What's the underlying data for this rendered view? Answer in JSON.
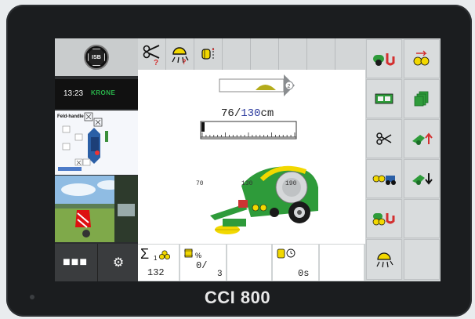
{
  "device": {
    "brand": "CCI 800"
  },
  "left": {
    "isb_label": "ISB",
    "time": "13:23",
    "logo_text": "KRONE",
    "handle_label": "Feld-handle"
  },
  "main": {
    "current_size": "76",
    "target_size": "130",
    "unit": "cm",
    "progress_fraction": 0.79,
    "scale": {
      "min": "70",
      "mid": "130",
      "max": "190",
      "marker_value": 70
    },
    "shift_badge": "2"
  },
  "bottom": {
    "bale_count_prefix": "1",
    "bale_count": "132",
    "percent_value": "0/",
    "percent_sub": "3",
    "timer_value": "0s"
  },
  "colors": {
    "green": "#2e9b3a",
    "yellow": "#f2d800",
    "red": "#d32f2f"
  }
}
